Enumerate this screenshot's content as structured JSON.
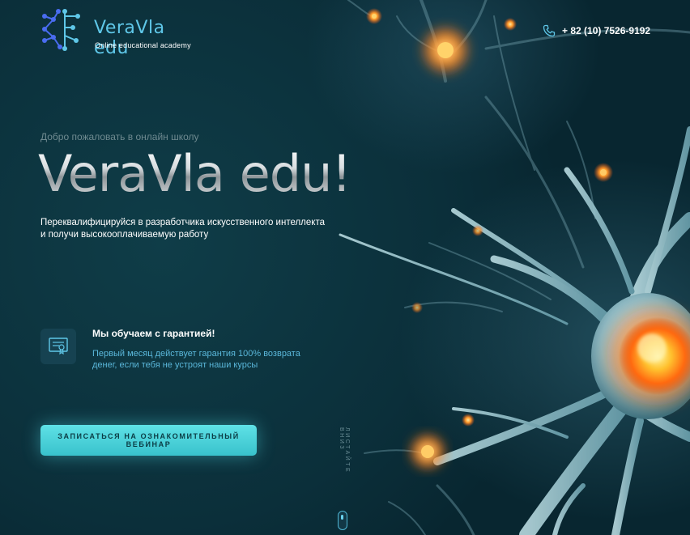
{
  "header": {
    "logo": {
      "name": "VeraVla edu",
      "subtitle": "Online educational academy"
    },
    "phone": {
      "icon": "phone-icon",
      "number": "+ 82 (10) 7526-9192"
    }
  },
  "hero": {
    "welcome": "Добро пожаловать в онлайн школу",
    "title": "VeraVla edu!",
    "subtitle_lines": [
      "Переквалифицируйся в разработчика искусственного интеллекта",
      "и получи высокооплачиваемую работу"
    ]
  },
  "guarantee": {
    "icon": "certificate-icon",
    "title": "Мы обучаем с гарантией!",
    "text_lines": [
      "Первый месяц действует гарантия 100% возврата",
      "денег, если тебя не устроят наши курсы"
    ]
  },
  "cta": {
    "label": "ЗАПИСАТЬСЯ НА ОЗНАКОМИТЕЛЬНЫЙ ВЕБИНАР"
  },
  "scroll": {
    "label": "ЛИСТАЙТЕ ВНИЗ",
    "icon": "mouse-scroll-icon"
  },
  "colors": {
    "accent": "#5fc7e8",
    "button": "#4fd3da",
    "background": "#0d3540",
    "highlight_text": "#5ab7da"
  }
}
